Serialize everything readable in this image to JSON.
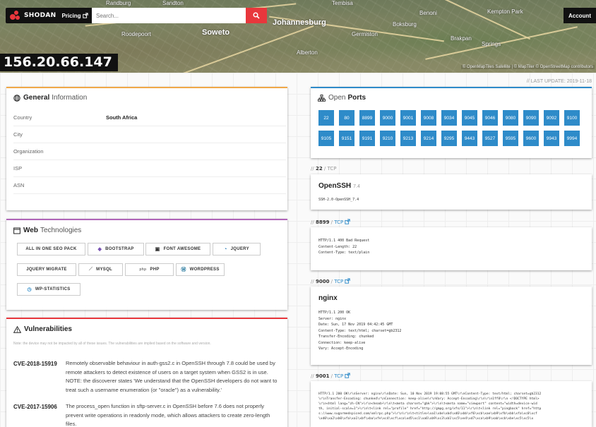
{
  "header": {
    "brand": "SHODAN",
    "pricing_label": "Pricing",
    "search_placeholder": "Search...",
    "account_label": "Account",
    "ip": "156.20.66.147",
    "map_attribution": "© OpenMapTiles Satellite | © MapTiler © OpenStreetMap contributors",
    "places": [
      "Sandton",
      "Johannesburg",
      "Soweto",
      "Germiston",
      "Boksburg",
      "Benoni",
      "Brakpan",
      "Springs",
      "Kempton Park",
      "Tembisa",
      "Randburg",
      "Roodepoort",
      "Alberton"
    ]
  },
  "last_update": "// LAST UPDATE: 2019-11-18",
  "general": {
    "title_bold": "General",
    "title_rest": "Information",
    "rows": [
      {
        "label": "Country",
        "value": "South Africa"
      },
      {
        "label": "City",
        "value": ""
      },
      {
        "label": "Organization",
        "value": ""
      },
      {
        "label": "ISP",
        "value": ""
      },
      {
        "label": "ASN",
        "value": ""
      }
    ]
  },
  "web": {
    "title_bold": "Web",
    "title_rest": "Technologies",
    "items": [
      "ALL IN ONE SEO PACK",
      "BOOTSTRAP",
      "FONT AWESOME",
      "JQUERY",
      "JQUERY MIGRATE",
      "MYSQL",
      "PHP",
      "WORDPRESS",
      "WP-STATISTICS"
    ]
  },
  "vulns": {
    "title": "Vulnerabilities",
    "note": "Note: the device may not be impacted by all of these issues. The vulnerabilities are implied based on the software and version.",
    "items": [
      {
        "id": "CVE-2018-15919",
        "desc": "Remotely observable behaviour in auth-gss2.c in OpenSSH through 7.8 could be used by remote attackers to detect existence of users on a target system when GSS2 is in use. NOTE: the discoverer states 'We understand that the OpenSSH developers do not want to treat such a username enumeration (or \"oracle\") as a vulnerability.'"
      },
      {
        "id": "CVE-2017-15906",
        "desc": "The process_open function in sftp-server.c in OpenSSH before 7.6 does not properly prevent write operations in readonly mode, which allows attackers to create zero-length files."
      }
    ]
  },
  "ports": {
    "title_light": "Open",
    "title_bold": "Ports",
    "list": [
      "22",
      "80",
      "8899",
      "9000",
      "9001",
      "9008",
      "9034",
      "9045",
      "9046",
      "9080",
      "9090",
      "9092",
      "9100",
      "9105",
      "9151",
      "9191",
      "9210",
      "9213",
      "9214",
      "9295",
      "9443",
      "9527",
      "9595",
      "9600",
      "9943",
      "9994"
    ]
  },
  "services": [
    {
      "port": "22",
      "proto": "TCP",
      "name": "OpenSSH",
      "version": "7.4",
      "banner": "SSH-2.0-OpenSSH_7.4"
    },
    {
      "port": "8899",
      "proto": "TCP",
      "name": "",
      "version": "",
      "banner": "HTTP/1.1 400 Bad Request\nContent-Length: 22\nContent-Type: text/plain"
    },
    {
      "port": "9000",
      "proto": "TCP",
      "name": "nginx",
      "version": "",
      "banner": "HTTP/1.1 200 OK\nServer: nginx\nDate: Sun, 17 Nov 2019 04:42:45 GMT\nContent-Type: text/html; charset=gb2312\nTransfer-Encoding: chunked\nConnection: keep-alive\nVary: Accept-Encoding"
    },
    {
      "port": "9001",
      "proto": "TCP",
      "name": "",
      "version": "",
      "banner": "HTTP/1.1 200 OK\\r\\nServer: nginx\\r\\nDate: Sun, 10 Nov 2019 19:08:55 GMT\\r\\nContent-Type: text/html; charset=gb2312\n\\r\\nTransfer-Encoding: chunked\\r\\nConnection: keep-alive\\r\\nVary: Accept-Encoding\\r\\n\\r\\n1ff8\\r\\n <!DOCTYPE html>\n\\r\\n<html lang=\"zh-CN\">\\r\\n<head>\\r\\n\\t<meta charset=\"gbk\">\\r\\n\\t<meta name=\"viewport\" content=\"width=device-wid\nth, initial-scale=1\">\\r\\n\\t<link rel=\"profile\" href=\"http://gmpg.org/xfn/11\">\\r\\n\\t<link rel=\"pingback\" href=\"http\ns://www.sugarmedspiced.com/xmlrpc.php\">\\r\\n\\r\\n\\t<title>\\xa1\\xbe\\xbd\\xd6\\xbb\\xf6\\xcb\\xae\\xb9\\xfb\\xbb\\xfa\\xc8\\xcf\n\\xd0\\xa2\\xb0\\xfa\\xa1\\xbf\\xba\\xfe\\xc4\\xcf\\xca\\xd5\\xc1\\xa6\\xb9\\xc3\\xb1\\xc5\\xe4\\xd7\\xca\\xb9\\xab\\xcb\\xbe\\xc5\\xc5\\x"
    }
  ]
}
